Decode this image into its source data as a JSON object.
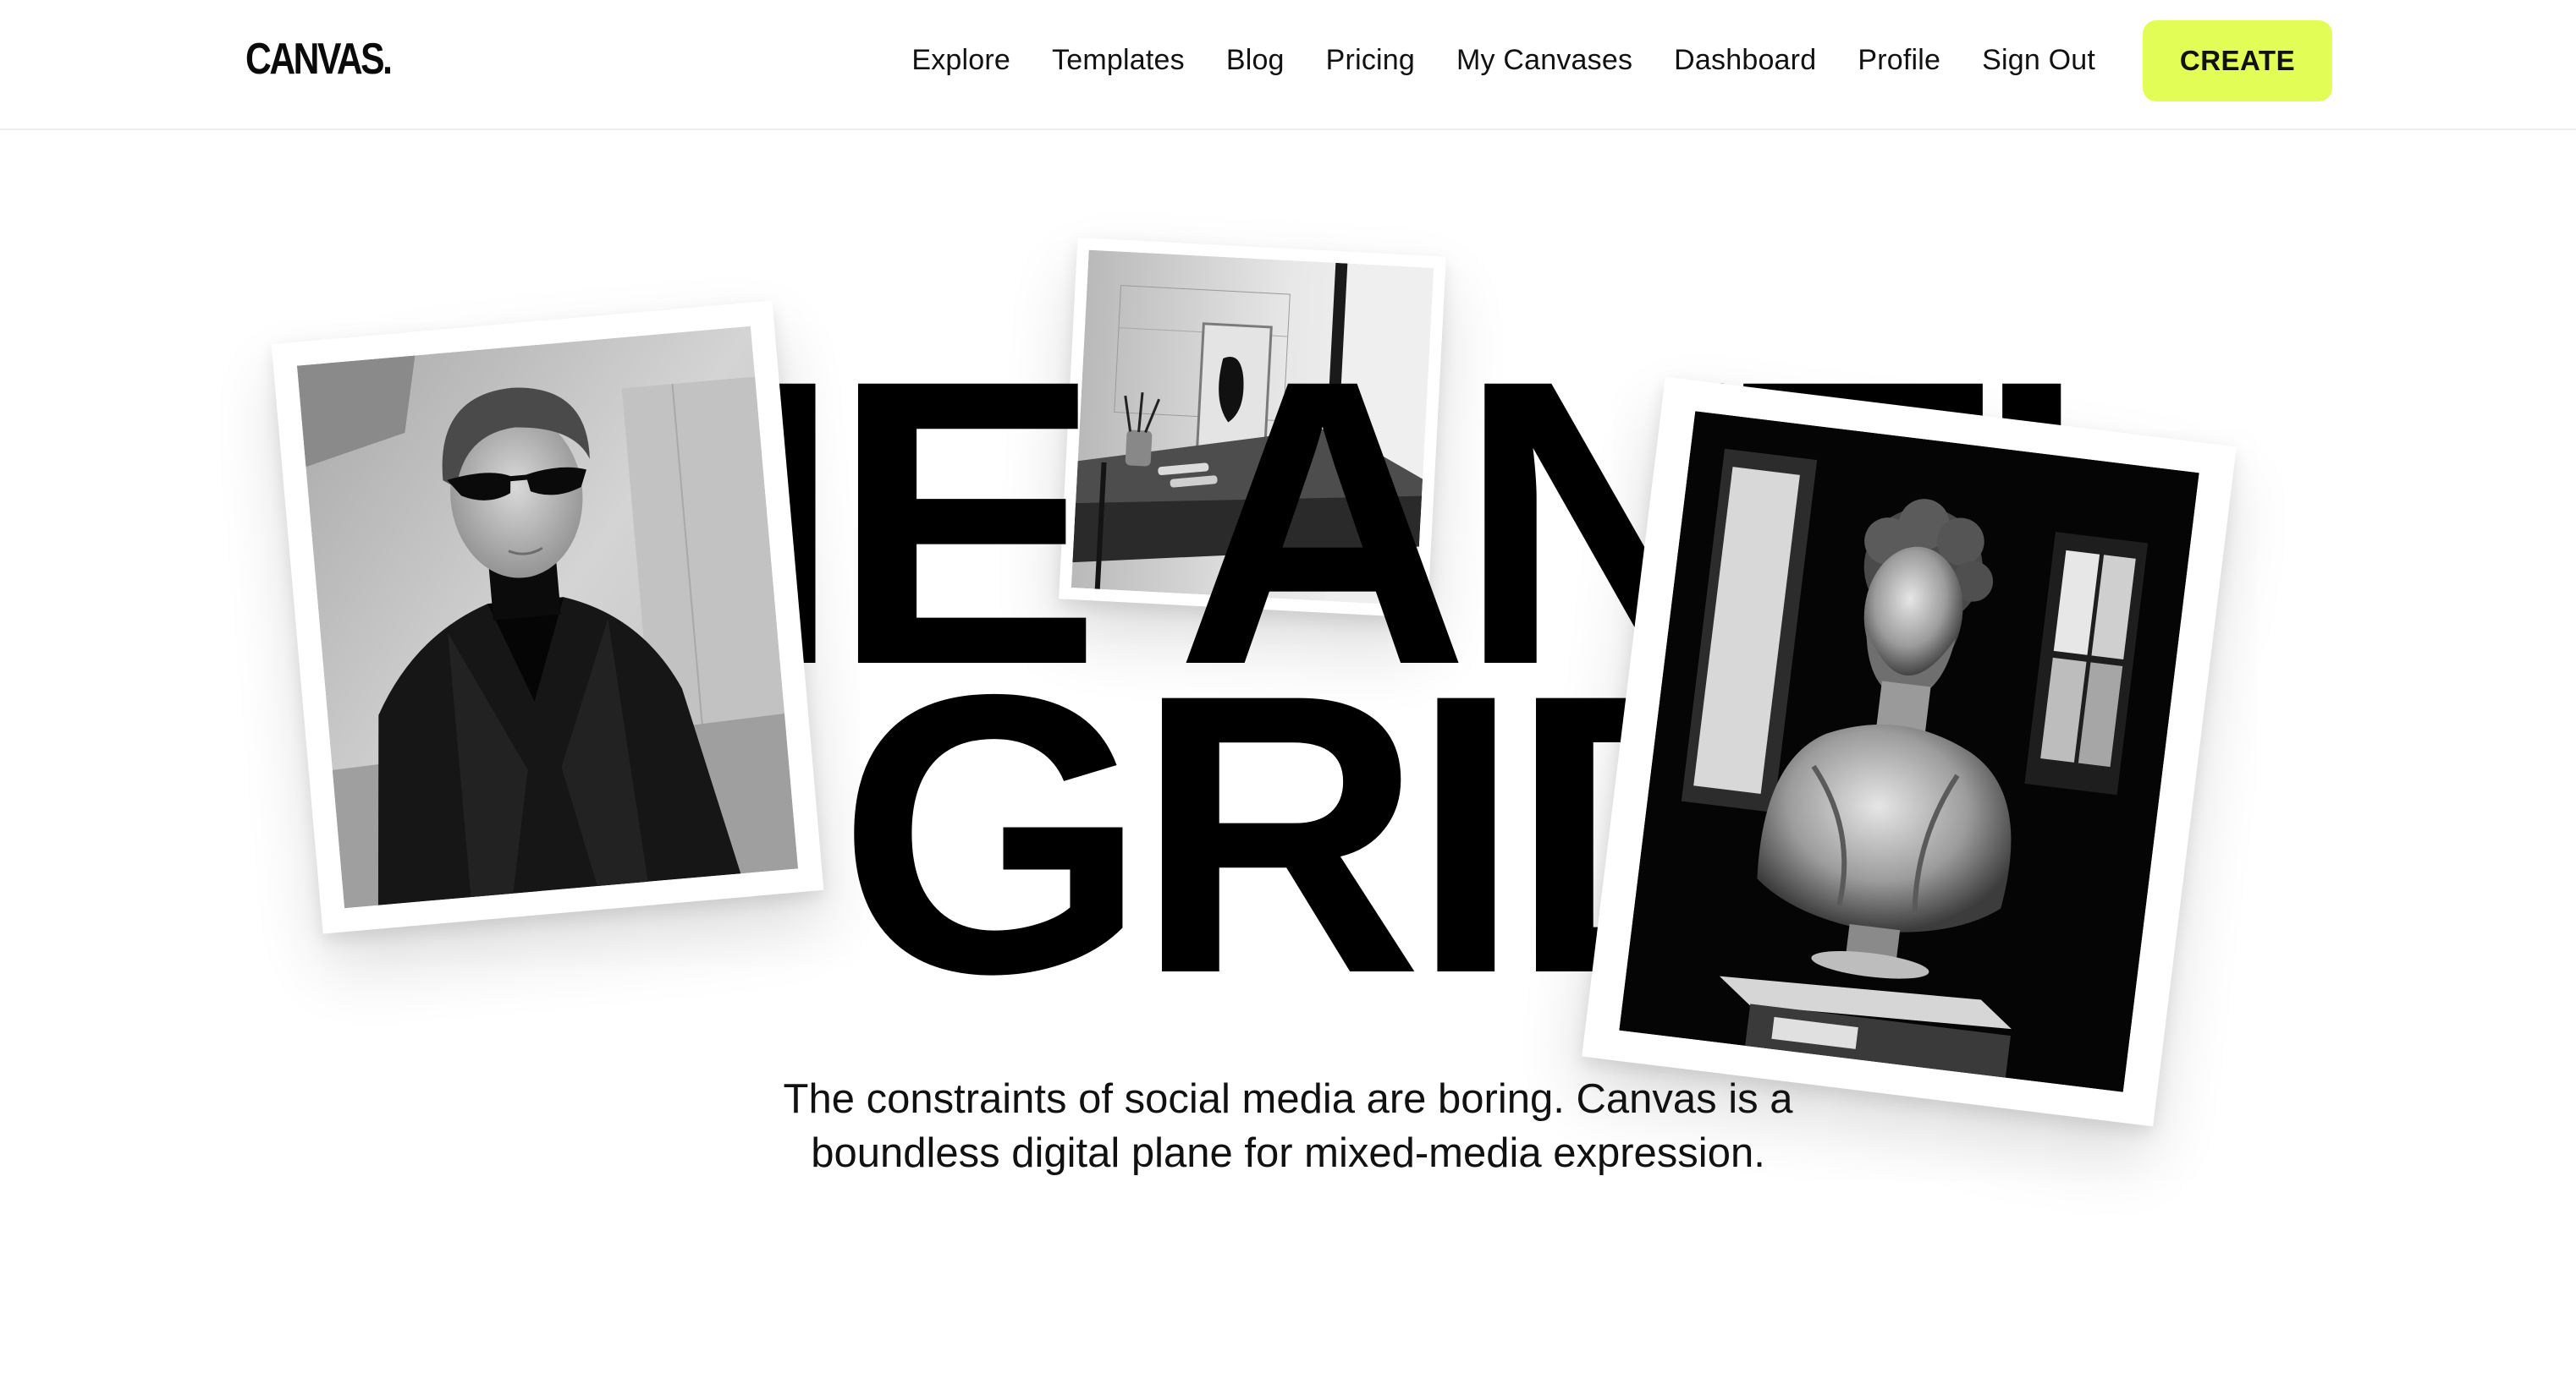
{
  "brand": {
    "logo_text": "CANVAS."
  },
  "nav": {
    "links": [
      {
        "label": "Explore"
      },
      {
        "label": "Templates"
      },
      {
        "label": "Blog"
      },
      {
        "label": "Pricing"
      },
      {
        "label": "My Canvases"
      },
      {
        "label": "Dashboard"
      },
      {
        "label": "Profile"
      },
      {
        "label": "Sign Out"
      }
    ],
    "cta_label": "CREATE",
    "cta_color": "#e2fd55"
  },
  "hero": {
    "line1": "THE ANTI-",
    "line2": "GRID",
    "tagline": "The constraints of social media are boring. Canvas is a boundless digital plane for mixed-media expression.",
    "photos": [
      {
        "subject": "man-in-sunglasses-photo"
      },
      {
        "subject": "desk-still-life-photo"
      },
      {
        "subject": "marble-bust-photo"
      }
    ]
  }
}
